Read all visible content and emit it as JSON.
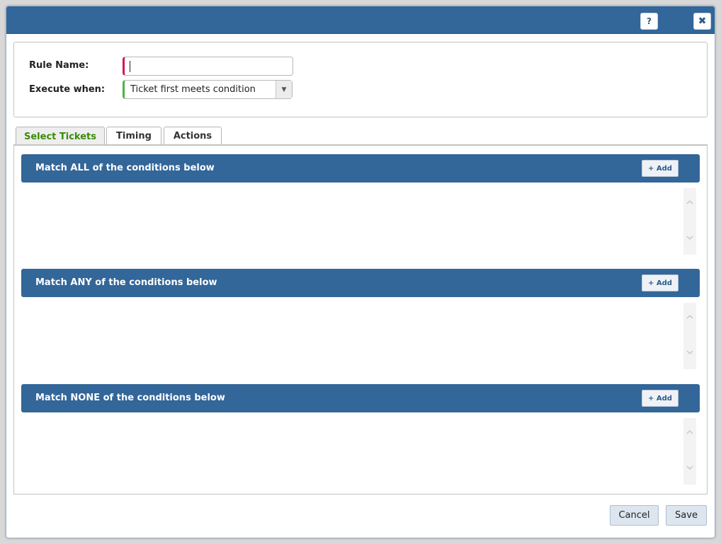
{
  "dialog": {
    "help_label": "?",
    "close_label": "✖"
  },
  "form": {
    "rule_name_label": "Rule Name:",
    "rule_name_value": "",
    "execute_when_label": "Execute when:",
    "execute_when_value": "Ticket first meets condition"
  },
  "tabs": [
    {
      "label": "Select Tickets",
      "active": true
    },
    {
      "label": "Timing",
      "active": false
    },
    {
      "label": "Actions",
      "active": false
    }
  ],
  "sections": [
    {
      "title": "Match ALL of the conditions below",
      "add_label": "+ Add"
    },
    {
      "title": "Match ANY of the conditions below",
      "add_label": "+ Add"
    },
    {
      "title": "Match NONE of the conditions below",
      "add_label": "+ Add"
    }
  ],
  "footer": {
    "cancel_label": "Cancel",
    "save_label": "Save"
  },
  "colors": {
    "header_blue": "#336699",
    "required_red": "#d4145a",
    "valid_green": "#4bb543",
    "active_tab_text": "#3a8a0a"
  }
}
